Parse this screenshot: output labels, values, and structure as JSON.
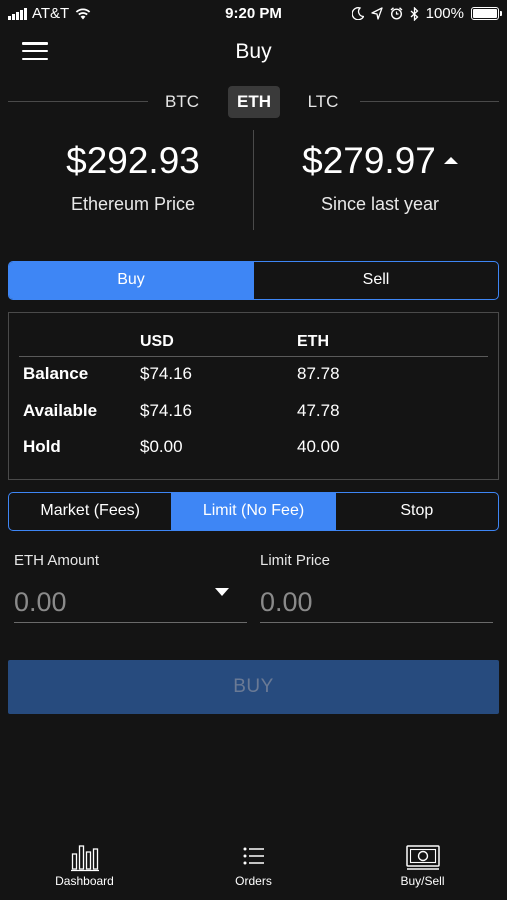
{
  "status_bar": {
    "carrier": "AT&T",
    "time": "9:20 PM",
    "battery": "100%"
  },
  "nav": {
    "title": "Buy"
  },
  "currency_tabs": [
    {
      "label": "BTC",
      "active": false
    },
    {
      "label": "ETH",
      "active": true
    },
    {
      "label": "LTC",
      "active": false
    }
  ],
  "prices": {
    "current": {
      "value": "$292.93",
      "label": "Ethereum Price"
    },
    "change": {
      "value": "$279.97",
      "label": "Since last year",
      "direction": "up"
    }
  },
  "side_toggle": [
    {
      "label": "Buy",
      "active": true
    },
    {
      "label": "Sell",
      "active": false
    }
  ],
  "balances": {
    "columns": [
      "USD",
      "ETH"
    ],
    "rows": [
      {
        "label": "Balance",
        "usd": "$74.16",
        "eth": "87.78"
      },
      {
        "label": "Available",
        "usd": "$74.16",
        "eth": "47.78"
      },
      {
        "label": "Hold",
        "usd": "$0.00",
        "eth": "40.00"
      }
    ]
  },
  "order_types": [
    {
      "label": "Market (Fees)",
      "active": false
    },
    {
      "label": "Limit (No Fee)",
      "active": true
    },
    {
      "label": "Stop",
      "active": false
    }
  ],
  "form": {
    "amount": {
      "label": "ETH Amount",
      "placeholder": "0.00"
    },
    "limit_price": {
      "label": "Limit Price",
      "placeholder": "0.00"
    }
  },
  "submit_label": "BUY",
  "tabbar": [
    {
      "label": "Dashboard",
      "icon": "bar-chart-icon"
    },
    {
      "label": "Orders",
      "icon": "list-icon"
    },
    {
      "label": "Buy/Sell",
      "icon": "cash-icon"
    }
  ],
  "colors": {
    "accent": "#3e86f5",
    "background": "#141414",
    "button_disabled": "#274b7e"
  }
}
